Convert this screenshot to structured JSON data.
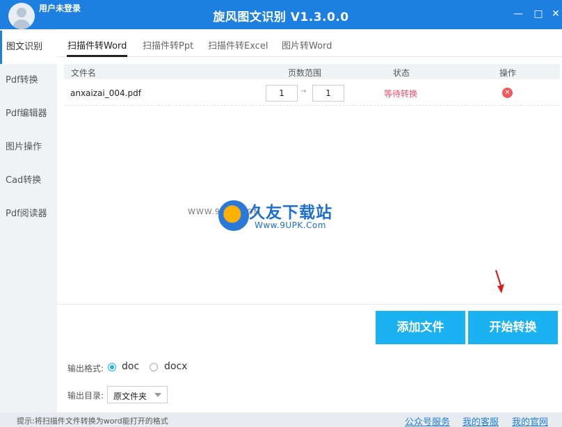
{
  "titlebar": {
    "user_label": "用户未登录",
    "app_title": "旋风图文识别 V1.3.0.0",
    "minimize_glyph": "—",
    "maximize_glyph": "□",
    "close_glyph": "✕"
  },
  "sidebar": {
    "items": [
      {
        "label": "图文识别",
        "active": true
      },
      {
        "label": "Pdf转换"
      },
      {
        "label": "Pdf编辑器"
      },
      {
        "label": "图片操作"
      },
      {
        "label": "Cad转换"
      },
      {
        "label": "Pdf阅读器"
      }
    ]
  },
  "tabs": [
    {
      "label": "扫描件转Word",
      "active": true
    },
    {
      "label": "扫描件转Ppt"
    },
    {
      "label": "扫描件转Excel"
    },
    {
      "label": "图片转Word"
    }
  ],
  "table": {
    "headers": [
      "文件名",
      "页数范围",
      "状态",
      "操作"
    ],
    "rows": [
      {
        "filename": "anxaizai_004.pdf",
        "page_from": "1",
        "page_to": "1",
        "status": "等待转换",
        "action_icon": "delete-icon"
      }
    ]
  },
  "watermark": {
    "small_url": "WWW.9UPK.COM",
    "title": "久友下载站",
    "url": "Www.9UPK.Com"
  },
  "actions": {
    "add_file": "添加文件",
    "start_convert": "开始转换"
  },
  "output": {
    "format_label": "输出格式:",
    "formats": [
      {
        "label": "doc",
        "selected": true
      },
      {
        "label": "docx",
        "selected": false
      }
    ],
    "dir_label": "输出目录:",
    "dir_value": "原文件夹"
  },
  "statusbar": {
    "hint": "提示:将扫描件文件转换为word能打开的格式",
    "links": [
      "公众号服务",
      "我的客服",
      "我的官网"
    ]
  },
  "colors": {
    "titlebar": "#1d7fe0",
    "button": "#1ab2f0",
    "status_waiting": "#f0506e",
    "delete": "#f05a5a"
  }
}
